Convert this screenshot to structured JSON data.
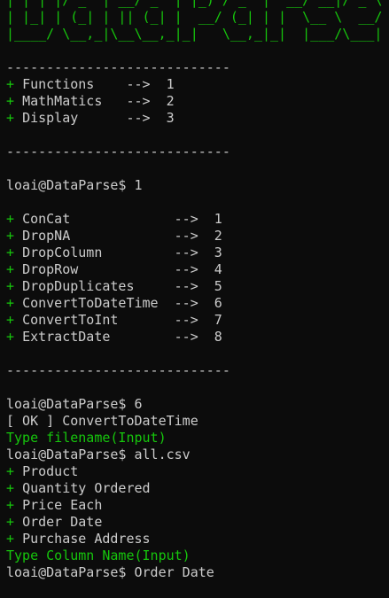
{
  "ascii_banner": [
    "| | | |/ _` | __/ _` | |_) / _` | '__/ __|/ _ \\",
    "| |_| | (_| | || (_| |  __/ (_| | |  \\__ \\  __/",
    "|____/ \\__,_|\\__\\__,_|_|   \\__,_|_|  |___/\\___|"
  ],
  "separator": "----------------------------",
  "main_menu": [
    {
      "label": "Functions    -->  1"
    },
    {
      "label": "MathMatics   -->  2"
    },
    {
      "label": "Display      -->  3"
    }
  ],
  "prompt1": "loai@DataParse$ 1",
  "functions_menu": [
    {
      "label": "ConCat             -->  1"
    },
    {
      "label": "DropNA             -->  2"
    },
    {
      "label": "DropColumn         -->  3"
    },
    {
      "label": "DropRow            -->  4"
    },
    {
      "label": "DropDuplicates     -->  5"
    },
    {
      "label": "ConvertToDateTime  -->  6"
    },
    {
      "label": "ConvertToInt       -->  7"
    },
    {
      "label": "ExtractDate        -->  8"
    }
  ],
  "prompt2": "loai@DataParse$ 6",
  "ok_message": "[ OK ] ConvertToDateTime",
  "filename_request": "Type filename(Input)",
  "prompt3": "loai@DataParse$ all.csv",
  "columns": [
    {
      "label": "Product"
    },
    {
      "label": "Quantity Ordered"
    },
    {
      "label": "Price Each"
    },
    {
      "label": "Order Date"
    },
    {
      "label": "Purchase Address"
    }
  ],
  "column_request": "Type Column Name(Input)",
  "prompt4": "loai@DataParse$ Order Date",
  "bullet": "+ "
}
